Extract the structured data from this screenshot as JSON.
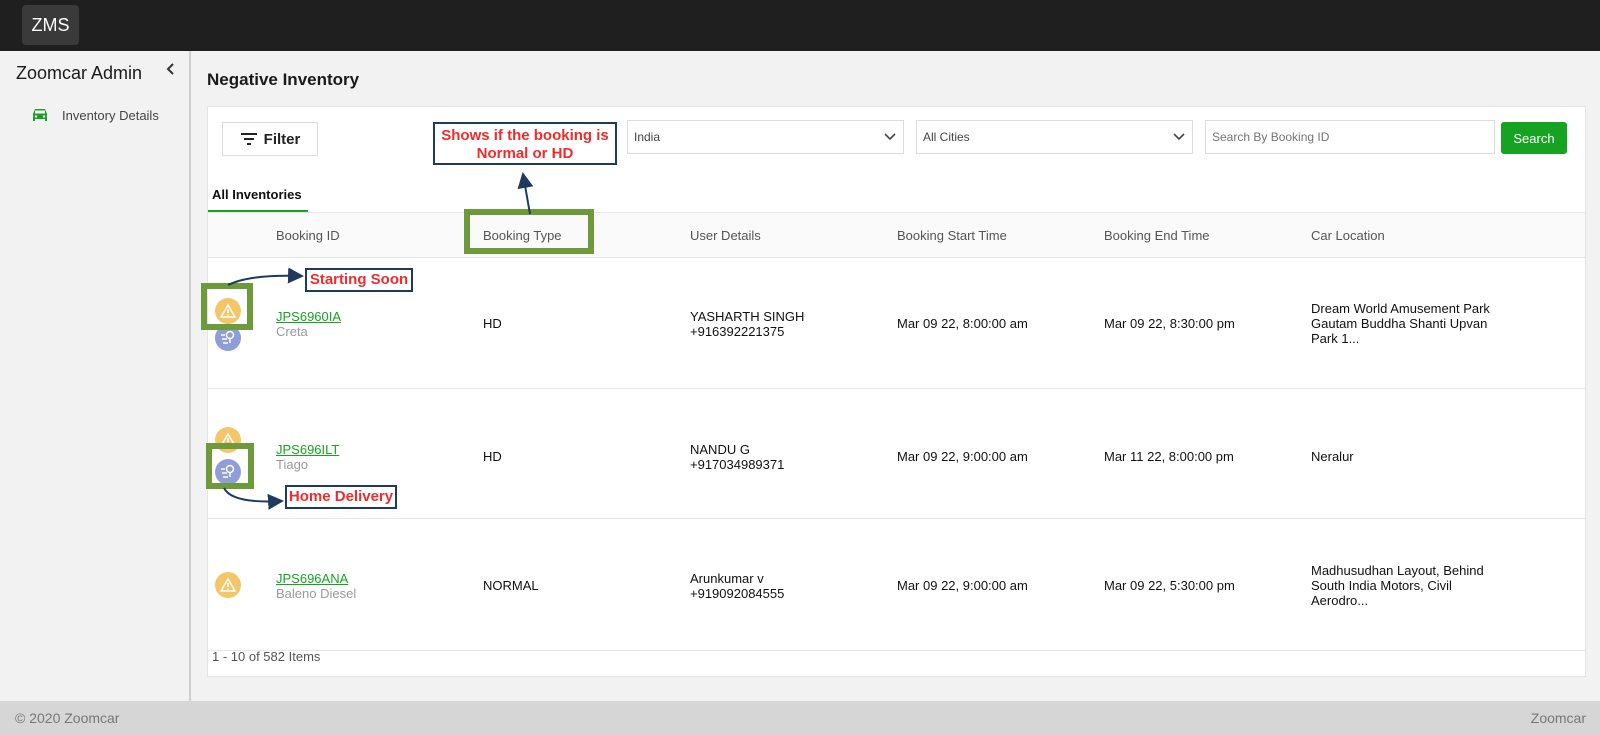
{
  "app": {
    "logo": "ZMS"
  },
  "sidebar": {
    "title": "Zoomcar Admin",
    "collapse_icon": "chevron-left-icon",
    "items": [
      {
        "label": "Inventory Details",
        "icon": "car-icon"
      }
    ]
  },
  "page": {
    "title": "Negative Inventory"
  },
  "filters": {
    "filter_label": "Filter",
    "country": "India",
    "city": "All Cities",
    "search_placeholder": "Search By Booking ID",
    "search_button": "Search"
  },
  "tabs": [
    {
      "label": "All Inventories",
      "active": true
    }
  ],
  "table": {
    "columns": [
      "Booking ID",
      "Booking Type",
      "User Details",
      "Booking Start Time",
      "Booking End Time",
      "Car Location"
    ],
    "rows": [
      {
        "booking_id": "JPS6960IA",
        "car": "Creta",
        "type": "HD",
        "user_name": "YASHARTH SINGH",
        "user_phone": "+916392221375",
        "start": "Mar 09 22, 8:00:00 am",
        "end": "Mar 09 22, 8:30:00 pm",
        "location": "Dream World Amusement Park Gautam Buddha Shanti Upvan Park 1...",
        "icons": [
          "warning-icon",
          "delivery-icon"
        ]
      },
      {
        "booking_id": "JPS696ILT",
        "car": "Tiago",
        "type": "HD",
        "user_name": "NANDU G",
        "user_phone": "+917034989371",
        "start": "Mar 09 22, 9:00:00 am",
        "end": "Mar 11 22, 8:00:00 pm",
        "location": "Neralur",
        "icons": [
          "warning-icon",
          "delivery-icon"
        ]
      },
      {
        "booking_id": "JPS696ANA",
        "car": "Baleno Diesel",
        "type": "NORMAL",
        "user_name": "Arunkumar v",
        "user_phone": "+919092084555",
        "start": "Mar 09 22, 9:00:00 am",
        "end": "Mar 09 22, 5:30:00 pm",
        "location": "Madhusudhan Layout, Behind South India Motors, Civil Aerodro...",
        "icons": [
          "warning-icon"
        ]
      }
    ],
    "pagination": "1 - 10 of 582 Items"
  },
  "annotations": {
    "booking_type": "Shows if the booking is Normal or HD",
    "starting_soon": "Starting Soon",
    "home_delivery": "Home Delivery"
  },
  "footer": {
    "copyright": "© 2020 Zoomcar",
    "brand": "Zoomcar"
  },
  "colors": {
    "accent": "#16a322",
    "warning": "#f4c66a",
    "delivery": "#8f9ed8",
    "annotation_red": "#ee2c2c",
    "highlight": "#6d9a3b"
  }
}
